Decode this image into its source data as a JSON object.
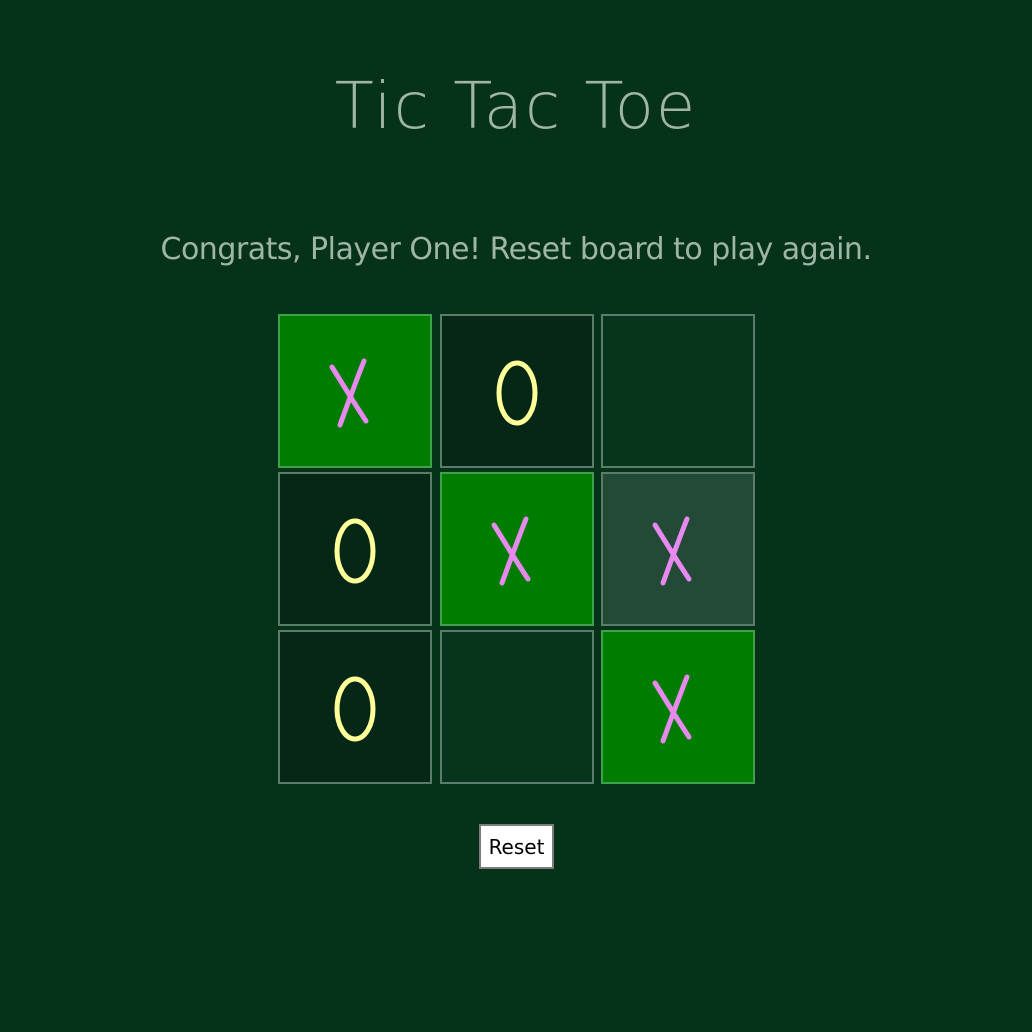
{
  "title": "Tic Tac Toe",
  "status": "Congrats, Player One! Reset board to play again.",
  "reset_label": "Reset",
  "colors": {
    "background": "#06321a",
    "text": "#9fb6a5",
    "x_mark": "#e889f0",
    "o_mark": "#ffff99",
    "win_cell": "#007c00",
    "dark_cell": "#062716",
    "empty_cell": "#07341b",
    "hover_cell": "#224a36"
  },
  "board": {
    "cells": [
      {
        "mark": "X",
        "state": "win"
      },
      {
        "mark": "O",
        "state": "dark"
      },
      {
        "mark": "",
        "state": "empty"
      },
      {
        "mark": "O",
        "state": "dark"
      },
      {
        "mark": "X",
        "state": "win"
      },
      {
        "mark": "X",
        "state": "hover"
      },
      {
        "mark": "O",
        "state": "dark"
      },
      {
        "mark": "",
        "state": "empty"
      },
      {
        "mark": "X",
        "state": "win"
      }
    ]
  }
}
